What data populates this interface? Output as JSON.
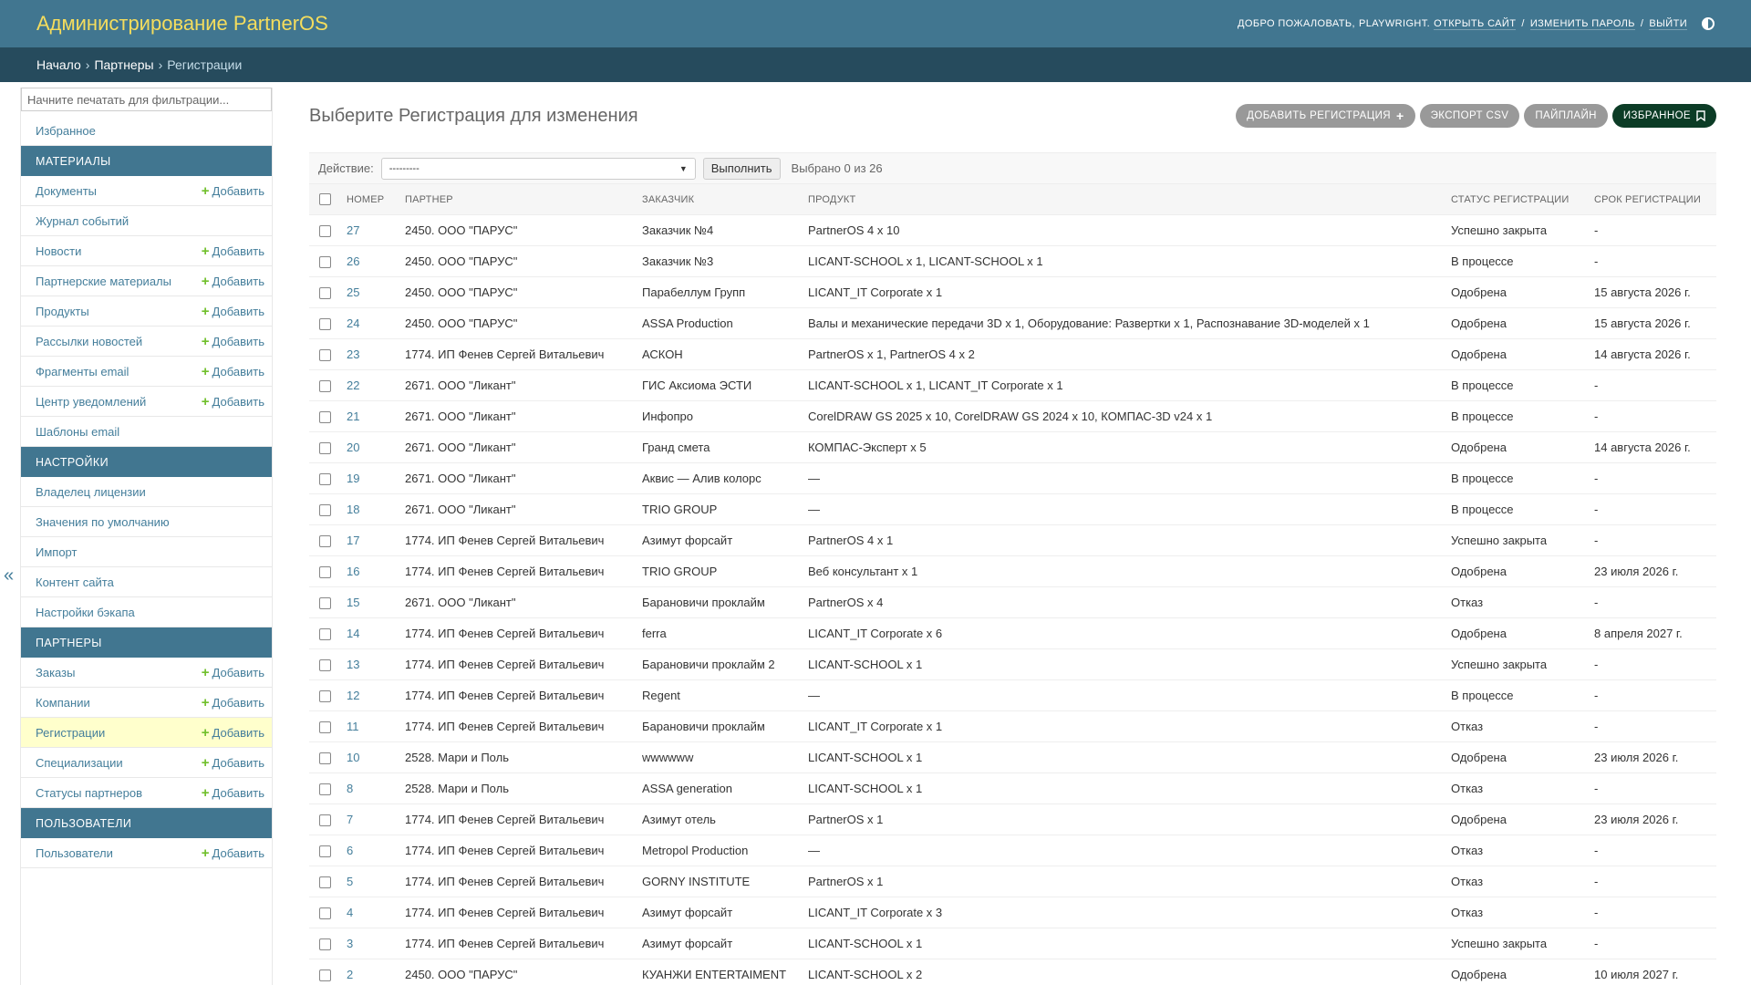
{
  "header": {
    "branding": "Администрирование PartnerOS",
    "welcome": "Добро пожаловать,",
    "username": "PLAYWRIGHT.",
    "view_site": "Открыть сайт",
    "change_password": "Изменить пароль",
    "logout": "Выйти"
  },
  "breadcrumbs": {
    "home": "Начало",
    "app": "Партнеры",
    "current": "Регистрации"
  },
  "sidebar": {
    "filter_placeholder": "Начните печатать для фильтрации...",
    "favorites": "Избранное",
    "add_label": "Добавить",
    "collapse_glyph": "«",
    "modules": [
      {
        "caption": "Материалы",
        "items": [
          {
            "label": "Документы",
            "add": true
          },
          {
            "label": "Журнал событий",
            "add": false
          },
          {
            "label": "Новости",
            "add": true
          },
          {
            "label": "Партнерские материалы",
            "add": true
          },
          {
            "label": "Продукты",
            "add": true
          },
          {
            "label": "Рассылки новостей",
            "add": true
          },
          {
            "label": "Фрагменты email",
            "add": true
          },
          {
            "label": "Центр уведомлений",
            "add": true
          },
          {
            "label": "Шаблоны email",
            "add": false
          }
        ]
      },
      {
        "caption": "Настройки",
        "items": [
          {
            "label": "Владелец лицензии",
            "add": false
          },
          {
            "label": "Значения по умолчанию",
            "add": false
          },
          {
            "label": "Импорт",
            "add": false
          },
          {
            "label": "Контент сайта",
            "add": false
          },
          {
            "label": "Настройки бэкапа",
            "add": false
          }
        ]
      },
      {
        "caption": "Партнеры",
        "items": [
          {
            "label": "Заказы",
            "add": true
          },
          {
            "label": "Компании",
            "add": true
          },
          {
            "label": "Регистрации",
            "add": true,
            "current": true
          },
          {
            "label": "Специализации",
            "add": true
          },
          {
            "label": "Статусы партнеров",
            "add": true
          }
        ]
      },
      {
        "caption": "Пользователи",
        "items": [
          {
            "label": "Пользователи",
            "add": true
          }
        ]
      }
    ]
  },
  "content": {
    "title": "Выберите Регистрация для изменения",
    "tools": {
      "add": "Добавить Регистрация",
      "export": "Экспорт CSV",
      "pipeline": "Пайплайн",
      "favorites": "Избранное"
    },
    "actions": {
      "label": "Действие:",
      "selected": "---------",
      "go": "Выполнить",
      "counter": "Выбрано 0 из 26"
    },
    "columns": [
      "Номер",
      "Партнер",
      "Заказчик",
      "Продукт",
      "Статус регистрации",
      "Срок регистрации"
    ],
    "rows": [
      [
        "27",
        "2450. ООО \"ПАРУС\"",
        "Заказчик №4",
        "PartnerOS 4 x 10",
        "Успешно закрыта",
        "-"
      ],
      [
        "26",
        "2450. ООО \"ПАРУС\"",
        "Заказчик №3",
        "LICANT-SCHOOL x 1, LICANT-SCHOOL x 1",
        "В процессе",
        "-"
      ],
      [
        "25",
        "2450. ООО \"ПАРУС\"",
        "Парабеллум Групп",
        "LICANT_IT Corporate x 1",
        "Одобрена",
        "15 августа 2026 г."
      ],
      [
        "24",
        "2450. ООО \"ПАРУС\"",
        "ASSA Production",
        "Валы и механические передачи 3D x 1, Оборудование: Развертки x 1, Распознавание 3D-моделей x 1",
        "Одобрена",
        "15 августа 2026 г."
      ],
      [
        "23",
        "1774. ИП Фенев Сергей Витальевич",
        "АСКОН",
        "PartnerOS x 1, PartnerOS 4 x 2",
        "Одобрена",
        "14 августа 2026 г."
      ],
      [
        "22",
        "2671. ООО \"Ликант\"",
        "ГИС Аксиома ЭСТИ",
        "LICANT-SCHOOL x 1, LICANT_IT Corporate x 1",
        "В процессе",
        "-"
      ],
      [
        "21",
        "2671. ООО \"Ликант\"",
        "Инфопро",
        "CorelDRAW GS 2025 x 10, CorelDRAW GS 2024 x 10, КОМПАС-3D v24 x 1",
        "В процессе",
        "-"
      ],
      [
        "20",
        "2671. ООО \"Ликант\"",
        "Гранд смета",
        "КОМПАС-Эксперт x 5",
        "Одобрена",
        "14 августа 2026 г."
      ],
      [
        "19",
        "2671. ООО \"Ликант\"",
        "Аквис — Алив колорс",
        "—",
        "В процессе",
        "-"
      ],
      [
        "18",
        "2671. ООО \"Ликант\"",
        "TRIO GROUP",
        "—",
        "В процессе",
        "-"
      ],
      [
        "17",
        "1774. ИП Фенев Сергей Витальевич",
        "Азимут форсайт",
        "PartnerOS 4 x 1",
        "Успешно закрыта",
        "-"
      ],
      [
        "16",
        "1774. ИП Фенев Сергей Витальевич",
        "TRIO GROUP",
        "Веб консультант x 1",
        "Одобрена",
        "23 июля 2026 г."
      ],
      [
        "15",
        "2671. ООО \"Ликант\"",
        "Барановичи проклайм",
        "PartnerOS x 4",
        "Отказ",
        "-"
      ],
      [
        "14",
        "1774. ИП Фенев Сергей Витальевич",
        "ferra",
        "LICANT_IT Corporate x 6",
        "Одобрена",
        "8 апреля 2027 г."
      ],
      [
        "13",
        "1774. ИП Фенев Сергей Витальевич",
        "Барановичи проклайм 2",
        "LICANT-SCHOOL x 1",
        "Успешно закрыта",
        "-"
      ],
      [
        "12",
        "1774. ИП Фенев Сергей Витальевич",
        "Regent",
        "—",
        "В процессе",
        "-"
      ],
      [
        "11",
        "1774. ИП Фенев Сергей Витальевич",
        "Барановичи проклайм",
        "LICANT_IT Corporate x 1",
        "Отказ",
        "-"
      ],
      [
        "10",
        "2528. Мари и Поль",
        "wwwwww",
        "LICANT-SCHOOL x 1",
        "Одобрена",
        "23 июля 2026 г."
      ],
      [
        "8",
        "2528. Мари и Поль",
        "ASSA generation",
        "LICANT-SCHOOL x 1",
        "Отказ",
        "-"
      ],
      [
        "7",
        "1774. ИП Фенев Сергей Витальевич",
        "Азимут отель",
        "PartnerOS x 1",
        "Одобрена",
        "23 июля 2026 г."
      ],
      [
        "6",
        "1774. ИП Фенев Сергей Витальевич",
        "Metropol Production",
        "—",
        "Отказ",
        "-"
      ],
      [
        "5",
        "1774. ИП Фенев Сергей Витальевич",
        "GORNY INSTITUTE",
        "PartnerOS x 1",
        "Отказ",
        "-"
      ],
      [
        "4",
        "1774. ИП Фенев Сергей Витальевич",
        "Азимут форсайт",
        "LICANT_IT Corporate x 3",
        "Отказ",
        "-"
      ],
      [
        "3",
        "1774. ИП Фенев Сергей Витальевич",
        "Азимут форсайт",
        "LICANT-SCHOOL x 1",
        "Успешно закрыта",
        "-"
      ],
      [
        "2",
        "2450. ООО \"ПАРУС\"",
        "КУАНЖИ ENTERTAIMENT",
        "LICANT-SCHOOL x 2",
        "Одобрена",
        "10 июля 2027 г."
      ]
    ]
  },
  "colors": {
    "header_bg": "#417690",
    "breadcrumbs_bg": "#264b5d",
    "branding": "#f5dd5d",
    "link": "#447e9b",
    "current_row": "#ffffcc",
    "add_plus": "#70bf2b",
    "favorites_btn": "#0c3c26"
  }
}
